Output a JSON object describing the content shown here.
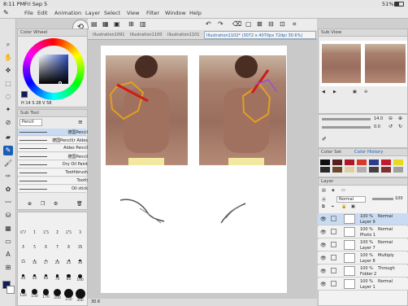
{
  "status_bar": {
    "time": "8:11 PM",
    "date": "Fri Sep 5",
    "battery": "51%"
  },
  "menu": [
    "File",
    "Edit",
    "Animation",
    "Layer",
    "Select",
    "View",
    "Filter",
    "Window",
    "Help"
  ],
  "tabs": [
    {
      "label": "Illustration1091",
      "active": false
    },
    {
      "label": "Illustration1100",
      "active": false
    },
    {
      "label": "Illustration1101",
      "active": false
    },
    {
      "label": "Illustration1102* (3072 x 4070px 72dpi 30.6%)",
      "active": true
    }
  ],
  "color_wheel": {
    "title": "Color Wheel",
    "h": "14",
    "s": "28",
    "v": "58"
  },
  "sub_tool": {
    "title": "Sub Tool",
    "group": "Pencil",
    "items": [
      "德国Pencil",
      "德国Pencil(r Aldes",
      "Aldes Pencil",
      "德国Pencil",
      "Dry Oil Paint",
      "Toothbrush",
      "Tooth",
      "Oil stick"
    ]
  },
  "brush_sizes": [
    "0.7",
    "1",
    "1.5",
    "2",
    "2.5",
    "3",
    "4",
    "5",
    "6",
    "7",
    "8",
    "10",
    "12",
    "16",
    "17",
    "20",
    "25",
    "30",
    "40",
    "50",
    "60",
    "70",
    "80",
    "100",
    "120",
    "150",
    "170",
    "200",
    "250",
    "300"
  ],
  "sub_view": {
    "title": "Sub View"
  },
  "navigator": {
    "zoom": "14.0",
    "rotation": "0.0"
  },
  "color_history": {
    "title": "Color History",
    "tab2": "Color Set"
  },
  "color_swatches": [
    "#101010",
    "#5a1d1d",
    "#b0182a",
    "#d63a2a",
    "#2c3c8a",
    "#c21c2c",
    "#e8d81e",
    "#2a2a2a",
    "#6a4a2a",
    "#e0d0a0",
    "#b0b0b0",
    "#404040",
    "#803030",
    "#a0a0a0"
  ],
  "layer_panel": {
    "title": "Layer",
    "blend_mode": "Normal",
    "opacity": "100",
    "layers": [
      {
        "opacity": "100 %",
        "mode": "Normal",
        "name": "Layer 9",
        "selected": true
      },
      {
        "opacity": "100 %",
        "mode": "Normal",
        "name": "Photo 1",
        "selected": false
      },
      {
        "opacity": "100 %",
        "mode": "Normal",
        "name": "Layer 7",
        "selected": false
      },
      {
        "opacity": "100 %",
        "mode": "Multiply",
        "name": "Layer 8",
        "selected": false
      },
      {
        "opacity": "100 %",
        "mode": "Through",
        "name": "Folder 2",
        "selected": false
      },
      {
        "opacity": "100 %",
        "mode": "Normal",
        "name": "Layer 1",
        "selected": false
      }
    ]
  },
  "canvas_zoom": "30.6",
  "colors": {
    "accent": "#1a5fb4",
    "layer_selected": "#c9dbf2"
  }
}
